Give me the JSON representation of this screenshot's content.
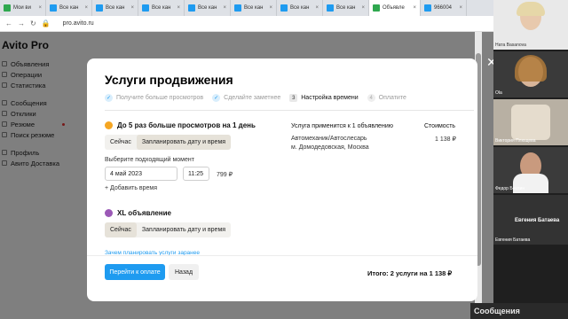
{
  "browser": {
    "tabs": [
      {
        "label": "Мои ви",
        "active": false
      },
      {
        "label": "Все кан",
        "active": false
      },
      {
        "label": "Все кан",
        "active": false
      },
      {
        "label": "Все кан",
        "active": false
      },
      {
        "label": "Все кан",
        "active": false
      },
      {
        "label": "Все кан",
        "active": false
      },
      {
        "label": "Все кан",
        "active": false
      },
      {
        "label": "Все кан",
        "active": false
      },
      {
        "label": "Объявле",
        "active": true
      },
      {
        "label": "966004",
        "active": false
      }
    ],
    "url": "pro.avito.ru"
  },
  "sidebar": {
    "logo": "Avito Pro",
    "items_top": [
      "Объявления",
      "Операции",
      "Статистика"
    ],
    "items_mid": [
      "Сообщения",
      "Отклики",
      "Резюме",
      "Поиск резюме"
    ],
    "items_bottom": [
      "Профиль",
      "Авито Доставка"
    ]
  },
  "modal": {
    "title": "Услуги продвижения",
    "steps": [
      {
        "badge": "✓",
        "label": "Получите больше просмотров",
        "state": "done"
      },
      {
        "badge": "✓",
        "label": "Сделайте заметнее",
        "state": "done"
      },
      {
        "badge": "3",
        "label": "Настройка времени",
        "state": "current"
      },
      {
        "badge": "4",
        "label": "Оплатите",
        "state": "todo"
      }
    ],
    "service1": {
      "title": "До 5 раз больше просмотров на 1 день",
      "option_now": "Сейчас",
      "option_schedule": "Запланировать дату и время",
      "hint": "Выберите подходящий момент",
      "date_value": "4 май 2023",
      "time_value": "11:25",
      "price": "799 ₽",
      "add_time": "Добавить время"
    },
    "service2": {
      "title": "XL объявление",
      "option_now": "Сейчас",
      "option_schedule": "Запланировать дату и время",
      "link": "Зачем планировать услуги заранее"
    },
    "right": {
      "applies_to": "Услуга применится к 1 объявлению",
      "cost_header": "Стоимость",
      "ad_title": "Автомеханик/Автослесарь",
      "ad_location": "м. Домодедовская, Москва",
      "ad_cost": "1 138 ₽"
    },
    "pay_button": "Перейти к оплате",
    "back_button": "Назад",
    "total": "Итого: 2 услуги на 1 138 ₽"
  },
  "video": {
    "participants": [
      {
        "name": "Ната Basanova"
      },
      {
        "name": "Ola"
      },
      {
        "name": "Виктория Плющева"
      },
      {
        "name": "Федор Беклин"
      },
      {
        "name": "Евгения Батаева"
      }
    ],
    "big_label": "Евгения Батаева",
    "bottom_label": "Сообщения"
  },
  "colors": {
    "accent": "#1e9bf0",
    "service1_icon": "#f5a623",
    "service2_icon": "#9b59b6"
  }
}
